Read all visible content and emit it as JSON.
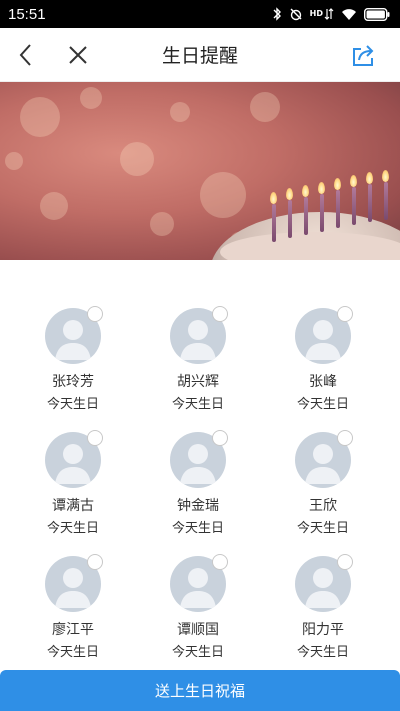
{
  "status_bar": {
    "time": "15:51",
    "hd_label": "HD"
  },
  "nav": {
    "title": "生日提醒"
  },
  "people": [
    {
      "name": "张玲芳",
      "note": "今天生日"
    },
    {
      "name": "胡兴辉",
      "note": "今天生日"
    },
    {
      "name": "张峰",
      "note": "今天生日"
    },
    {
      "name": "谭满古",
      "note": "今天生日"
    },
    {
      "name": "钟金瑞",
      "note": "今天生日"
    },
    {
      "name": "王欣",
      "note": "今天生日"
    },
    {
      "name": "廖江平",
      "note": "今天生日"
    },
    {
      "name": "谭顺国",
      "note": "今天生日"
    },
    {
      "name": "阳力平",
      "note": "今天生日"
    }
  ],
  "footer": {
    "send_label": "送上生日祝福"
  },
  "colors": {
    "accent": "#2f8fe6",
    "avatar_bg": "#c9d2dc"
  }
}
